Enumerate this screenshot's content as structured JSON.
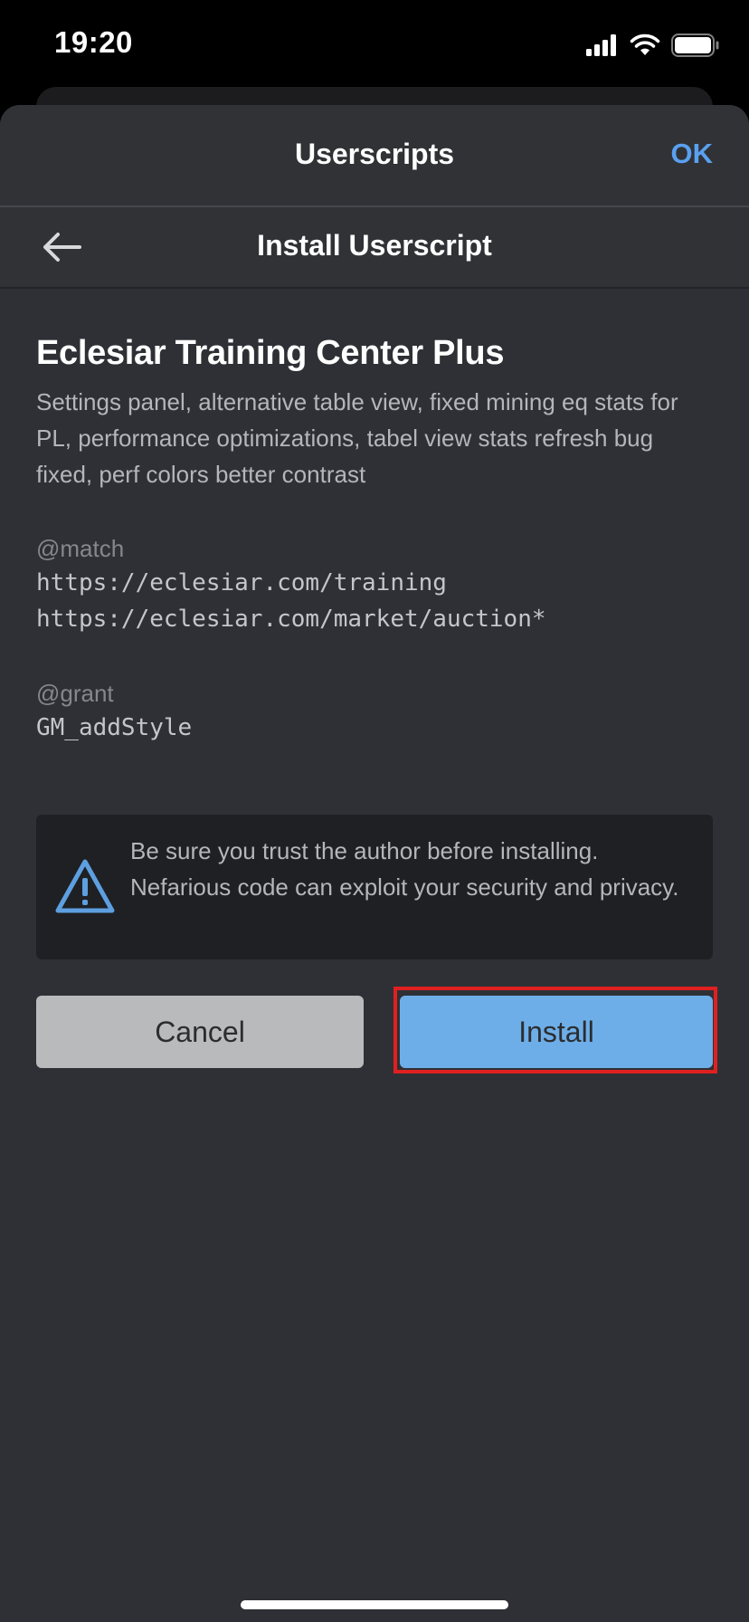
{
  "status_bar": {
    "time": "19:20",
    "icons": [
      "cellular-signal-icon",
      "wifi-icon",
      "battery-icon"
    ]
  },
  "sheet": {
    "title": "Userscripts",
    "ok_label": "OK"
  },
  "nav": {
    "back_icon": "arrow-left-icon",
    "title": "Install Userscript"
  },
  "script": {
    "name": "Eclesiar Training Center Plus",
    "description": "Settings panel, alternative table view, fixed mining eq stats for PL, performance optimizations, tabel view stats refresh bug fixed, perf colors better contrast",
    "match_label": "@match",
    "matches": [
      "https://eclesiar.com/training",
      "https://eclesiar.com/market/auction*"
    ],
    "grant_label": "@grant",
    "grants": [
      "GM_addStyle"
    ]
  },
  "warning": {
    "icon": "warning-triangle-icon",
    "text": "Be sure you trust the author before installing. Nefarious code can exploit your security and privacy."
  },
  "actions": {
    "cancel_label": "Cancel",
    "install_label": "Install"
  },
  "colors": {
    "accent": "#5aa0f0",
    "install_bg": "#6eaee8",
    "highlight": "#e02020",
    "sheet_bg": "#2e3035"
  }
}
